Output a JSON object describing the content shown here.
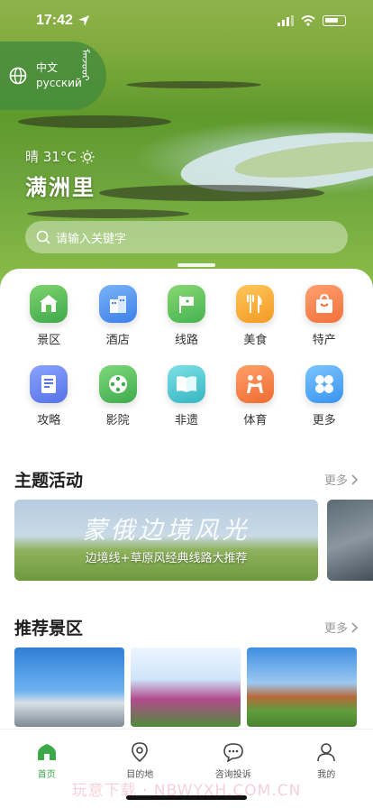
{
  "status": {
    "time": "17:42"
  },
  "language": {
    "options": [
      "中文",
      "русский"
    ],
    "mongolian": "ᠮᠠᠨᠵᠤᠤᠷ"
  },
  "weather": {
    "text": "晴 31°C"
  },
  "city": "满洲里",
  "search": {
    "placeholder": "请输入关键字"
  },
  "grid": [
    {
      "label": "景区",
      "icon": "scenic-icon",
      "color": "#4caf50"
    },
    {
      "label": "酒店",
      "icon": "hotel-icon",
      "color": "#3f8ef0"
    },
    {
      "label": "线路",
      "icon": "route-flag-icon",
      "color": "#48b54f"
    },
    {
      "label": "美食",
      "icon": "food-icon",
      "color": "#f3a22b"
    },
    {
      "label": "特产",
      "icon": "specialty-bag-icon",
      "color": "#f27a45"
    },
    {
      "label": "攻略",
      "icon": "guide-icon",
      "color": "#5b79e8"
    },
    {
      "label": "影院",
      "icon": "cinema-reel-icon",
      "color": "#4cb450"
    },
    {
      "label": "非遗",
      "icon": "heritage-book-icon",
      "color": "#3cbcc6"
    },
    {
      "label": "体育",
      "icon": "sports-wrestling-icon",
      "color": "#f27c3a"
    },
    {
      "label": "更多",
      "icon": "more-grid-icon",
      "color": "#3ea0f0"
    }
  ],
  "themes": {
    "title": "主题活动",
    "more": "更多",
    "banner_title": "蒙俄边境风光",
    "banner_subtitle": "边境线+草原风经典线路大推荐"
  },
  "recommend": {
    "title": "推荐景区",
    "more": "更多"
  },
  "tabs": [
    {
      "label": "首页",
      "icon": "home-yurt-icon",
      "active": true
    },
    {
      "label": "目的地",
      "icon": "location-pin-icon",
      "active": false
    },
    {
      "label": "咨询投诉",
      "icon": "chat-bubble-icon",
      "active": false
    },
    {
      "label": "我的",
      "icon": "user-icon",
      "active": false
    }
  ],
  "watermark": "玩意下载 · NBWYXH.COM.CN",
  "colors": {
    "accent": "#3ea94b",
    "search_bg": "rgba(255,255,255,0.38)"
  }
}
